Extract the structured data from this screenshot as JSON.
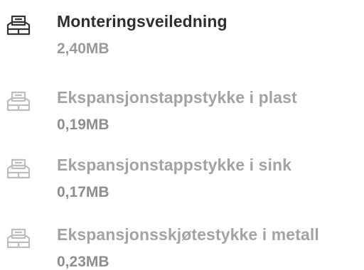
{
  "documents": [
    {
      "title": "Monteringsveiledning",
      "size": "2,40MB",
      "state": "active",
      "icon": "document-stack-icon"
    },
    {
      "title": "Ekspansjonstappstykke i plast",
      "size": "0,19MB",
      "state": "inactive",
      "icon": "document-stack-icon"
    },
    {
      "title": "Ekspansjonstappstykke i sink",
      "size": "0,17MB",
      "state": "inactive",
      "icon": "document-stack-icon"
    },
    {
      "title": "Ekspansjonsskjøtestykke i metall",
      "size": "0,23MB",
      "state": "inactive",
      "icon": "document-stack-icon"
    }
  ],
  "colors": {
    "active_title": "#2f2f2f",
    "inactive_title": "#a3a3a3",
    "size_text": "#9a9a9a",
    "background": "#ffffff"
  }
}
